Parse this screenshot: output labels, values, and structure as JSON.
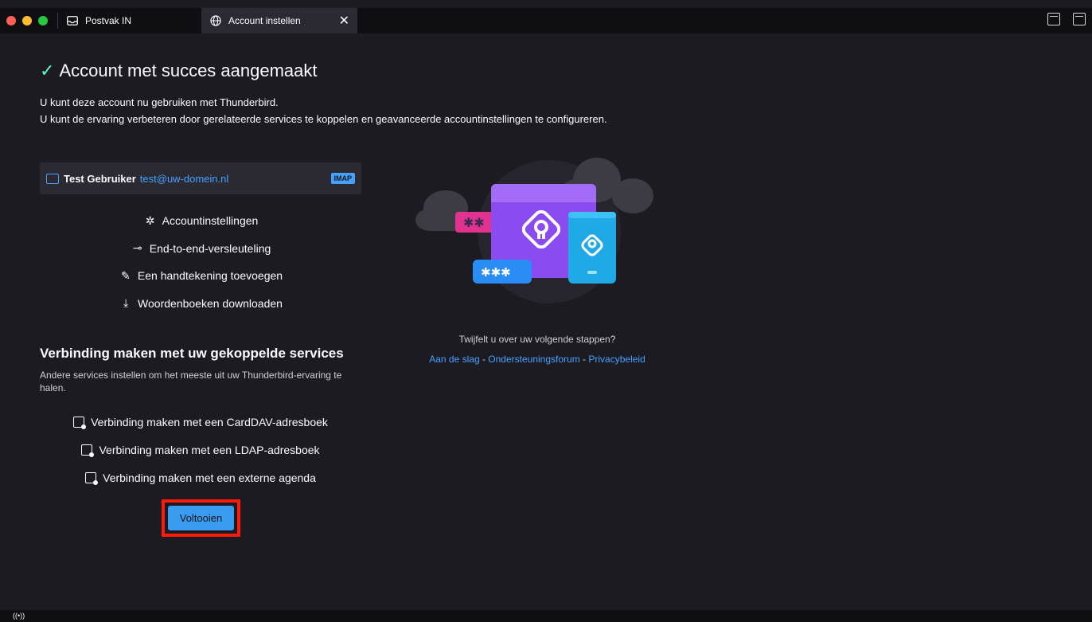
{
  "tabs": {
    "inbox_label": "Postvak IN",
    "active_label": "Account instellen",
    "close_glyph": "✕"
  },
  "page": {
    "check_glyph": "✓",
    "title": "Account met succes aangemaakt",
    "intro_line1": "U kunt deze account nu gebruiken met Thunderbird.",
    "intro_line2": "U kunt de ervaring verbeteren door gerelateerde services te koppelen en geavanceerde accountinstellingen te configureren."
  },
  "account": {
    "name": "Test Gebruiker",
    "email": "test@uw-domein.nl",
    "type": "IMAP"
  },
  "settings_links": [
    {
      "icon": "gear-icon",
      "glyph": "✲",
      "label": "Accountinstellingen"
    },
    {
      "icon": "key-icon",
      "glyph": "⊸",
      "label": "End-to-end-versleuteling"
    },
    {
      "icon": "pen-icon",
      "glyph": "✎",
      "label": "Een handtekening toevoegen"
    },
    {
      "icon": "download-icon",
      "glyph": "⤓",
      "label": "Woordenboeken downloaden"
    }
  ],
  "services": {
    "title": "Verbinding maken met uw gekoppelde services",
    "description": "Andere services instellen om het meeste uit uw Thunderbird-ervaring te halen.",
    "items": [
      {
        "icon": "address-book-icon",
        "label": "Verbinding maken met een CardDAV-adresboek"
      },
      {
        "icon": "address-book-icon",
        "label": "Verbinding maken met een LDAP-adresboek"
      },
      {
        "icon": "calendar-icon",
        "label": "Verbinding maken met een externe agenda"
      }
    ]
  },
  "finish_label": "Voltooien",
  "help": {
    "question": "Twijfelt u over uw volgende stappen?",
    "link1": "Aan de slag",
    "separator": " - ",
    "link2": "Ondersteuningsforum",
    "link3": "Privacybeleid"
  },
  "colors": {
    "background": "#1c1b22",
    "accent": "#45a1ff",
    "check": "#54ffbd",
    "highlight": "#ff1a0a"
  }
}
